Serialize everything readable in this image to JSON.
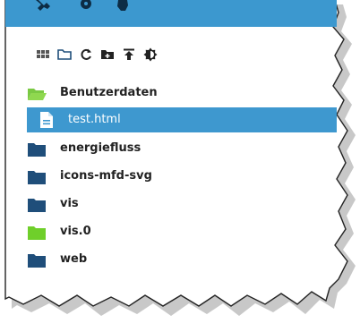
{
  "topbar": {
    "icons": [
      "wrench-icon",
      "gear-icon",
      "hand-icon"
    ],
    "color": "#3c98cf"
  },
  "toolbar": {
    "icons": [
      "grid-view-icon",
      "folder-icon",
      "refresh-icon",
      "new-folder-icon",
      "upload-icon",
      "theme-icon"
    ]
  },
  "tree": {
    "items": [
      {
        "label": "Benutzerdaten",
        "icon": "folder-open-icon",
        "color": "#7ac943"
      },
      {
        "label": "test.html",
        "icon": "file-document-icon",
        "selected": true
      },
      {
        "label": "energiefluss",
        "icon": "folder-icon",
        "color": "#1f4e7a"
      },
      {
        "label": "icons-mfd-svg",
        "icon": "folder-icon",
        "color": "#1f4e7a"
      },
      {
        "label": "vis",
        "icon": "folder-icon",
        "color": "#1f4e7a"
      },
      {
        "label": "vis.0",
        "icon": "folder-icon",
        "color": "#6fcf2a"
      },
      {
        "label": "web",
        "icon": "folder-icon",
        "color": "#1f4e7a"
      }
    ]
  },
  "colors": {
    "selection": "#3e98cf",
    "folder_dark": "#1f4e7a",
    "folder_green": "#6fcf2a"
  }
}
